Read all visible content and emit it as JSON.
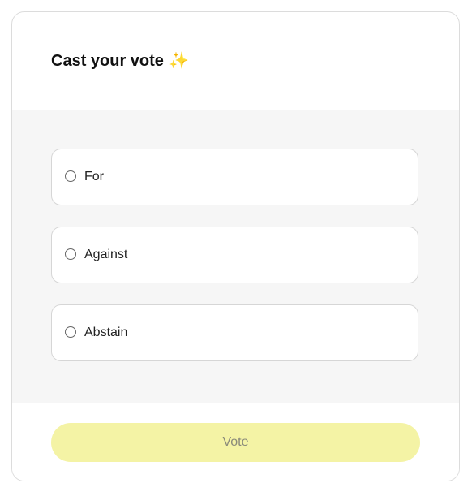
{
  "header": {
    "title": "Cast your vote",
    "title_emoji": "✨"
  },
  "options": [
    {
      "label": "For",
      "selected": false
    },
    {
      "label": "Against",
      "selected": false
    },
    {
      "label": "Abstain",
      "selected": false
    }
  ],
  "footer": {
    "vote_label": "Vote",
    "vote_enabled": false
  },
  "colors": {
    "button_bg": "#f4f3a5",
    "panel_bg": "#f6f6f6",
    "border": "#dcdcdc"
  }
}
